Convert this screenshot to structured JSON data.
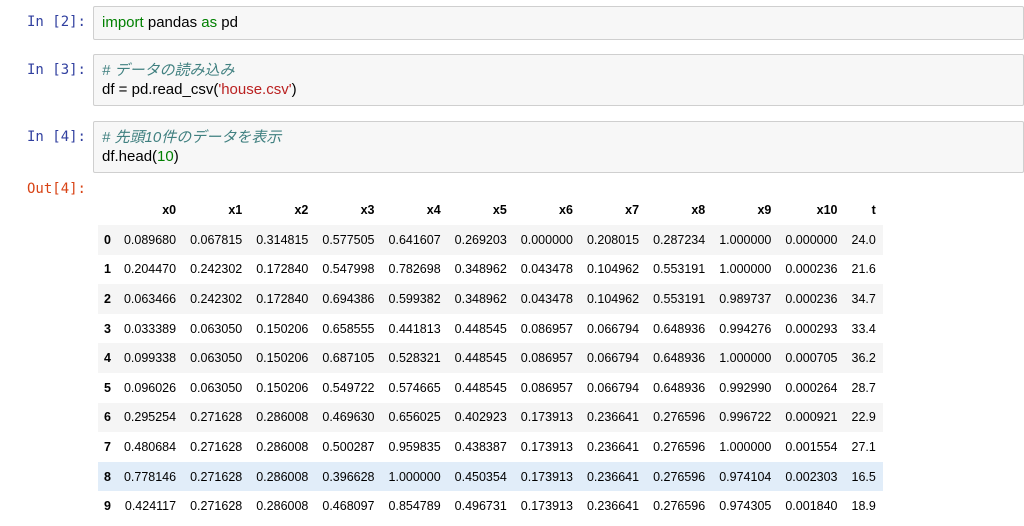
{
  "cells": [
    {
      "prompt": "In [2]:",
      "code": [
        [
          {
            "t": "kw",
            "v": "import"
          },
          {
            "t": "",
            "v": " pandas "
          },
          {
            "t": "kw",
            "v": "as"
          },
          {
            "t": "",
            "v": " pd"
          }
        ]
      ]
    },
    {
      "prompt": "In [3]:",
      "code": [
        [
          {
            "t": "cmt",
            "v": "# データの読み込み"
          }
        ],
        [
          {
            "t": "",
            "v": "df = pd.read_csv("
          },
          {
            "t": "str",
            "v": "'house.csv'"
          },
          {
            "t": "",
            "v": ")"
          }
        ]
      ]
    },
    {
      "prompt": "In [4]:",
      "code": [
        [
          {
            "t": "cmt",
            "v": "# 先頭10件のデータを表示"
          }
        ],
        [
          {
            "t": "",
            "v": "df.head("
          },
          {
            "t": "num",
            "v": "10"
          },
          {
            "t": "",
            "v": ")"
          }
        ]
      ]
    }
  ],
  "output": {
    "prompt": "Out[4]:",
    "columns": [
      "",
      "x0",
      "x1",
      "x2",
      "x3",
      "x4",
      "x5",
      "x6",
      "x7",
      "x8",
      "x9",
      "x10",
      "t"
    ],
    "highlighted_row": 8,
    "rows": [
      [
        "0",
        "0.089680",
        "0.067815",
        "0.314815",
        "0.577505",
        "0.641607",
        "0.269203",
        "0.000000",
        "0.208015",
        "0.287234",
        "1.000000",
        "0.000000",
        "24.0"
      ],
      [
        "1",
        "0.204470",
        "0.242302",
        "0.172840",
        "0.547998",
        "0.782698",
        "0.348962",
        "0.043478",
        "0.104962",
        "0.553191",
        "1.000000",
        "0.000236",
        "21.6"
      ],
      [
        "2",
        "0.063466",
        "0.242302",
        "0.172840",
        "0.694386",
        "0.599382",
        "0.348962",
        "0.043478",
        "0.104962",
        "0.553191",
        "0.989737",
        "0.000236",
        "34.7"
      ],
      [
        "3",
        "0.033389",
        "0.063050",
        "0.150206",
        "0.658555",
        "0.441813",
        "0.448545",
        "0.086957",
        "0.066794",
        "0.648936",
        "0.994276",
        "0.000293",
        "33.4"
      ],
      [
        "4",
        "0.099338",
        "0.063050",
        "0.150206",
        "0.687105",
        "0.528321",
        "0.448545",
        "0.086957",
        "0.066794",
        "0.648936",
        "1.000000",
        "0.000705",
        "36.2"
      ],
      [
        "5",
        "0.096026",
        "0.063050",
        "0.150206",
        "0.549722",
        "0.574665",
        "0.448545",
        "0.086957",
        "0.066794",
        "0.648936",
        "0.992990",
        "0.000264",
        "28.7"
      ],
      [
        "6",
        "0.295254",
        "0.271628",
        "0.286008",
        "0.469630",
        "0.656025",
        "0.402923",
        "0.173913",
        "0.236641",
        "0.276596",
        "0.996722",
        "0.000921",
        "22.9"
      ],
      [
        "7",
        "0.480684",
        "0.271628",
        "0.286008",
        "0.500287",
        "0.959835",
        "0.438387",
        "0.173913",
        "0.236641",
        "0.276596",
        "1.000000",
        "0.001554",
        "27.1"
      ],
      [
        "8",
        "0.778146",
        "0.271628",
        "0.286008",
        "0.396628",
        "1.000000",
        "0.450354",
        "0.173913",
        "0.236641",
        "0.276596",
        "0.974104",
        "0.002303",
        "16.5"
      ],
      [
        "9",
        "0.424117",
        "0.271628",
        "0.286008",
        "0.468097",
        "0.854789",
        "0.496731",
        "0.173913",
        "0.236641",
        "0.276596",
        "0.974305",
        "0.001840",
        "18.9"
      ]
    ]
  }
}
